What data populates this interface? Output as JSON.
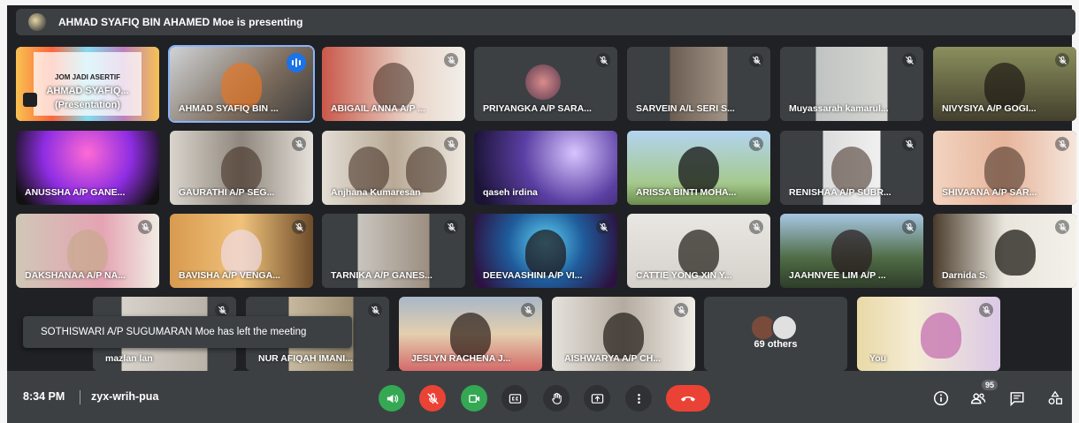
{
  "presenting": {
    "text": "AHMAD SYAFIQ BIN AHAMED Moe is presenting"
  },
  "tiles": [
    {
      "name": "AHMAD SYAFIQ... (Presentation)",
      "line1": "AHMAD SYAFIQ...",
      "line2": "(Presentation)",
      "slide_text": "JOM JADI ASERTIF"
    },
    {
      "name": "AHMAD SYAFIQ BIN ..."
    },
    {
      "name": "ABIGAIL ANNA A/P ..."
    },
    {
      "name": "PRIYANGKA A/P SARA..."
    },
    {
      "name": "SARVEIN A/L SERI S..."
    },
    {
      "name": "Muyassarah kamarul..."
    },
    {
      "name": "NIVYSIYA A/P GOGI..."
    },
    {
      "name": "ANUSSHA A/P GANE..."
    },
    {
      "name": "GAURATHI A/P SEG..."
    },
    {
      "name": "Anjhana Kumaresan"
    },
    {
      "name": "qaseh irdina"
    },
    {
      "name": "ARISSA BINTI MOHA..."
    },
    {
      "name": "RENISHAA A/P SUBR..."
    },
    {
      "name": "SHIVAANA A/P SAR..."
    },
    {
      "name": "DAKSHANAA A/P NA..."
    },
    {
      "name": "BAVISHA A/P VENGA..."
    },
    {
      "name": "TARNIKA A/P GANES..."
    },
    {
      "name": "DEEVAASHINI A/P VI..."
    },
    {
      "name": "CATTIE YONG XIN Y..."
    },
    {
      "name": "JAAHNVEE LIM A/P ..."
    },
    {
      "name": "Darnida S."
    },
    {
      "name": "mazlan lan"
    },
    {
      "name": "NUR AFIQAH IMANI..."
    },
    {
      "name": "JESLYN RACHENA J..."
    },
    {
      "name": "AISHWARYA A/P CH..."
    },
    {
      "name": "69 others"
    },
    {
      "name": "You"
    }
  ],
  "toast": {
    "text": "SOTHISWARI A/P SUGUMARAN Moe has left the meeting"
  },
  "bottom": {
    "time": "8:34 PM",
    "meeting_code": "zyx-wrih-pua",
    "participants_count": "95"
  },
  "colors": {
    "background": "#202124",
    "panel": "#3c4043",
    "accent_blue": "#1a73e8",
    "mic_red": "#ea4335",
    "green": "#34a853"
  }
}
